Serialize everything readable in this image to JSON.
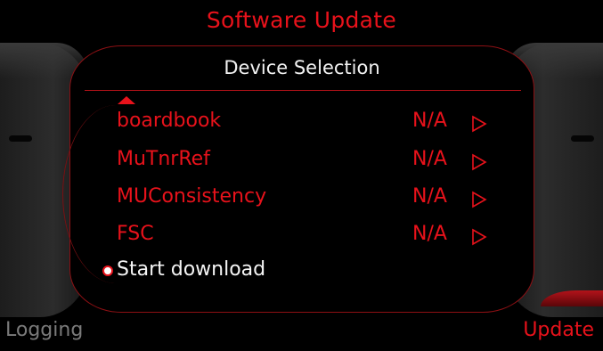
{
  "header": {
    "title": "Software Update"
  },
  "panel": {
    "title": "Device Selection"
  },
  "devices": [
    {
      "name": "boardbook",
      "value": "N/A"
    },
    {
      "name": "MuTnrRef",
      "value": "N/A"
    },
    {
      "name": "MUConsistency",
      "value": "N/A"
    },
    {
      "name": "FSC",
      "value": "N/A"
    }
  ],
  "start_download": {
    "label": "Start download"
  },
  "softkeys": {
    "left": "Logging",
    "right": "Update"
  },
  "colors": {
    "accent_red": "#e8121b",
    "text_white": "#f2f2f2",
    "disabled_gray": "#7a7a7a",
    "background": "#000000"
  },
  "icons": {
    "scroll_up": "up-triangle-icon",
    "row_arrow": "play-outline-icon",
    "selection_marker": "radio-dot-icon"
  }
}
